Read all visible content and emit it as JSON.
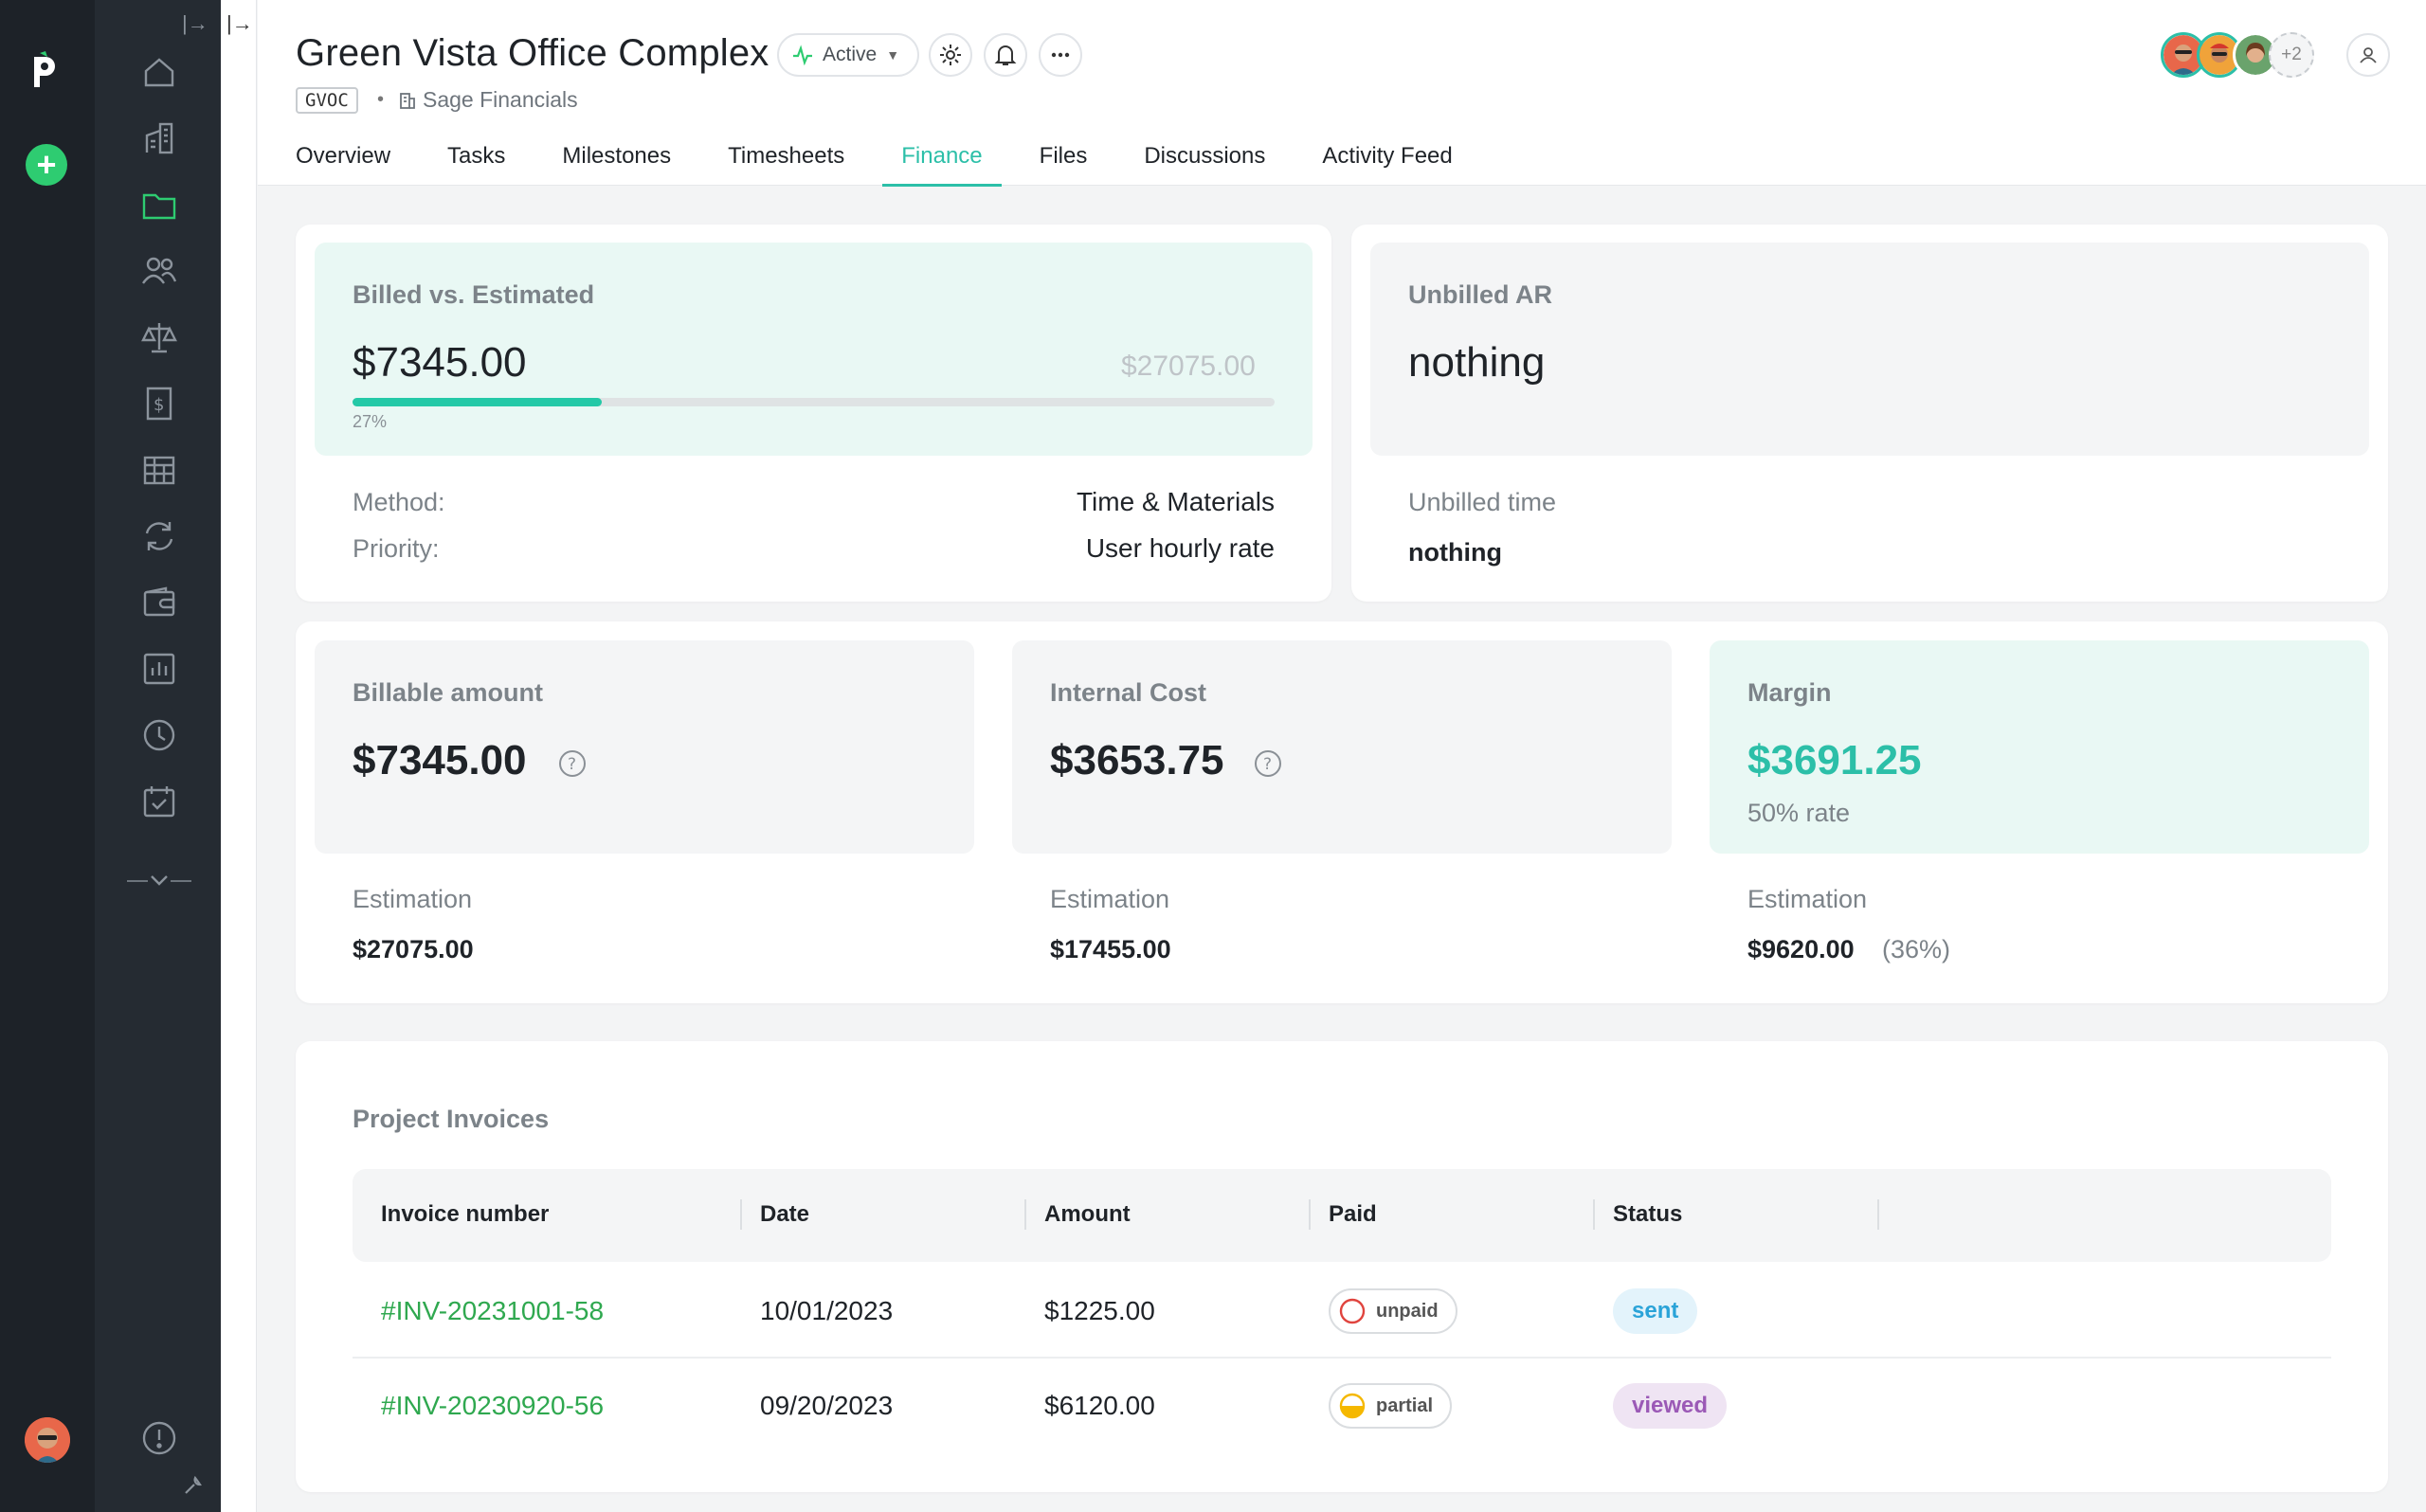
{
  "project": {
    "title": "Green Vista Office Complex",
    "status": "Active",
    "code": "GVOC",
    "client": "Sage Financials",
    "extra_members": "+2"
  },
  "tabs": [
    "Overview",
    "Tasks",
    "Milestones",
    "Timesheets",
    "Finance",
    "Files",
    "Discussions",
    "Activity Feed"
  ],
  "active_tab": "Finance",
  "billed": {
    "label": "Billed vs. Estimated",
    "amount": "$7345.00",
    "estimated": "$27075.00",
    "progress_label": "27%",
    "progress": 0.27,
    "method_label": "Method:",
    "method_value": "Time & Materials",
    "priority_label": "Priority:",
    "priority_value": "User hourly rate"
  },
  "unbilled": {
    "label": "Unbilled AR",
    "value": "nothing",
    "time_label": "Unbilled time",
    "time_value": "nothing"
  },
  "billable": {
    "label": "Billable amount",
    "amount": "$7345.00",
    "est_label": "Estimation",
    "est_value": "$27075.00"
  },
  "internal_cost": {
    "label": "Internal Cost",
    "amount": "$3653.75",
    "est_label": "Estimation",
    "est_value": "$17455.00"
  },
  "margin": {
    "label": "Margin",
    "amount": "$3691.25",
    "rate": "50% rate",
    "est_label": "Estimation",
    "est_value": "$9620.00",
    "est_pct": "(36%)"
  },
  "invoices": {
    "title": "Project Invoices",
    "columns": [
      "Invoice number",
      "Date",
      "Amount",
      "Paid",
      "Status"
    ],
    "rows": [
      {
        "number": "#INV-20231001-58",
        "date": "10/01/2023",
        "amount": "$1225.00",
        "paid": "unpaid",
        "status": "sent"
      },
      {
        "number": "#INV-20230920-56",
        "date": "09/20/2023",
        "amount": "$6120.00",
        "paid": "partial",
        "status": "viewed"
      }
    ]
  },
  "colors": {
    "accent": "#2cbfa8",
    "link": "#2fa84f",
    "rail_bg": "#1d2228",
    "nav_bg": "#252b32",
    "sent_bg": "#e3f3fb",
    "viewed_bg": "#efe4f3"
  },
  "nav_icons": [
    "home-icon",
    "buildings-icon",
    "folder-icon",
    "people-icon",
    "scales-icon",
    "invoice-icon",
    "table-icon",
    "sync-icon",
    "wallet-icon",
    "chart-icon",
    "clock-icon",
    "calendar-check-icon"
  ]
}
